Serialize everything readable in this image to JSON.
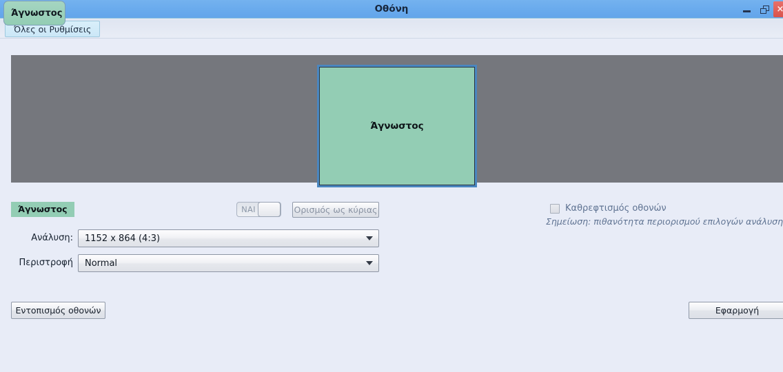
{
  "window": {
    "title": "Οθόνη",
    "controls": {
      "minimize": "minimize-icon",
      "restore": "restore-icon",
      "close": "×"
    }
  },
  "breadcrumb": {
    "all_settings_label": "Όλες οι Ρυθμίσεις"
  },
  "tooltip": {
    "monitor_name": "Άγνωστος"
  },
  "preview": {
    "monitor_label": "Άγνωστος",
    "background_color": "#75777d",
    "monitor_fill": "#93cdb4",
    "monitor_border": "#4a87c0"
  },
  "controls": {
    "monitor_badge": "Άγνωστος",
    "toggle_label": "ΝΑΙ",
    "toggle_state": "on",
    "primary_monitor_button": "Ορισμός ως κύριας"
  },
  "form": {
    "resolution_label": "Ανάλυση:",
    "resolution_value": "1152 x 864 (4:3)",
    "rotation_label": "Περιστροφή",
    "rotation_value": "Normal"
  },
  "right_column": {
    "mirror_label": "Καθρεφτισμός οθονών",
    "mirror_checked": false,
    "note": "Σημείωση: πιθανότητα περιορισμού επιλογών ανάλυσης"
  },
  "footer": {
    "detect_button": "Εντοπισμός οθονών",
    "apply_button": "Εφαρμογή"
  }
}
